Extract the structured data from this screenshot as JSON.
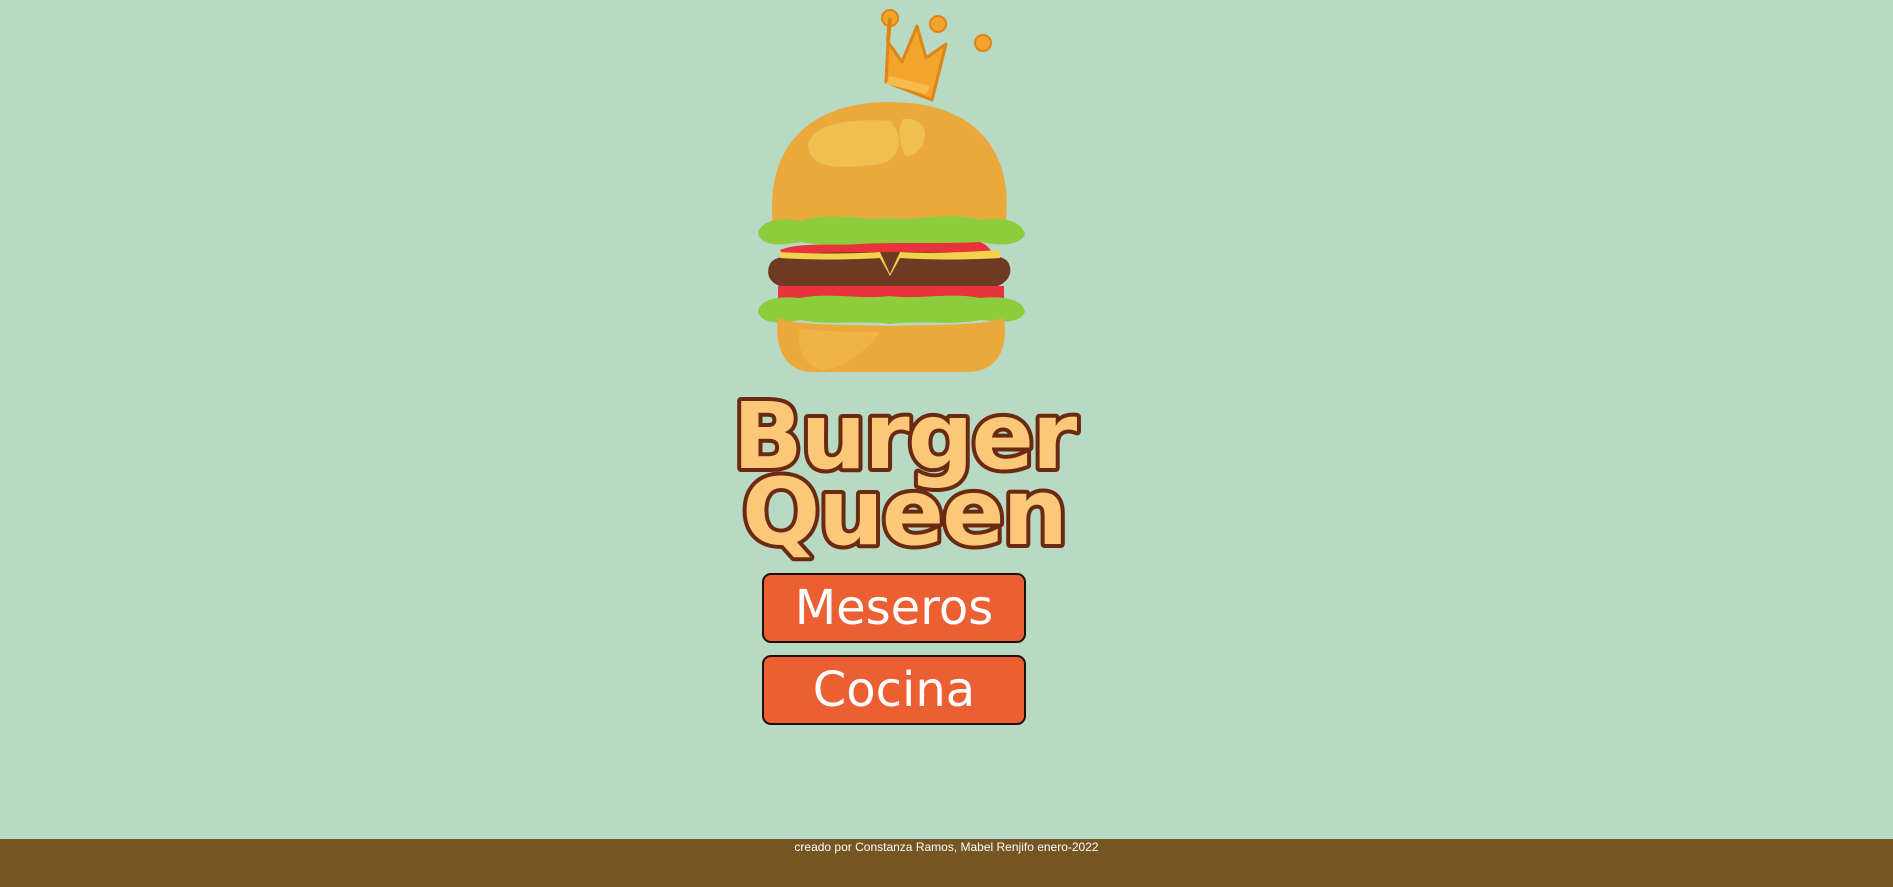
{
  "brand": {
    "line1": "Burger",
    "line2": "Queen"
  },
  "buttons": {
    "meseros": "Meseros",
    "cocina": "Cocina"
  },
  "footer": {
    "credit": "creado por Constanza Ramos, Mabel Renjifo enero-2022"
  },
  "colors": {
    "background": "#b8d9c3",
    "button": "#eb5f33",
    "footer": "#755522",
    "title_fill": "#fbc87a",
    "title_stroke": "#6b2a10"
  }
}
